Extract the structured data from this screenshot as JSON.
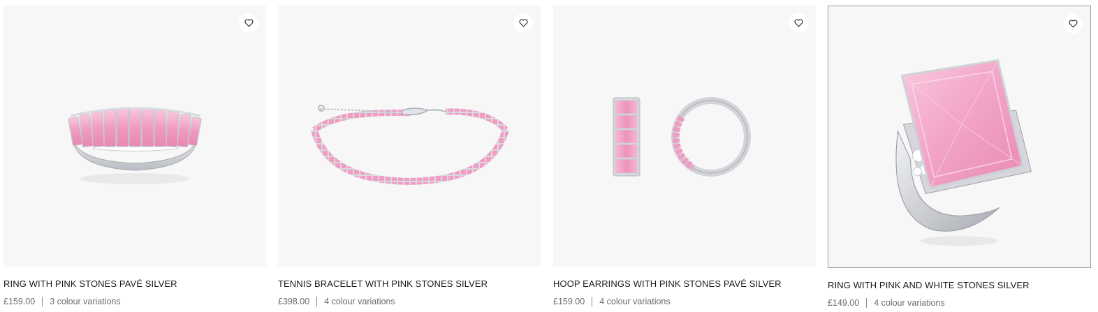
{
  "products": [
    {
      "title": "RING WITH PINK STONES PAVÉ SILVER",
      "price": "£159.00",
      "variations": "3 colour variations",
      "icon": "heart-icon"
    },
    {
      "title": "TENNIS BRACELET WITH PINK STONES SILVER",
      "price": "£398.00",
      "variations": "4 colour variations",
      "icon": "heart-icon"
    },
    {
      "title": "HOOP EARRINGS WITH PINK STONES PAVÉ SILVER",
      "price": "£159.00",
      "variations": "4 colour variations",
      "icon": "heart-icon"
    },
    {
      "title": "RING WITH PINK AND WHITE STONES SILVER",
      "price": "£149.00",
      "variations": "4 colour variations",
      "icon": "heart-icon"
    }
  ],
  "colors": {
    "image_bg": "#f7f7f7",
    "stone_pink": "#f2a9c8",
    "silver": "#d9dbe0",
    "hover_border": "#9a9a9a"
  }
}
